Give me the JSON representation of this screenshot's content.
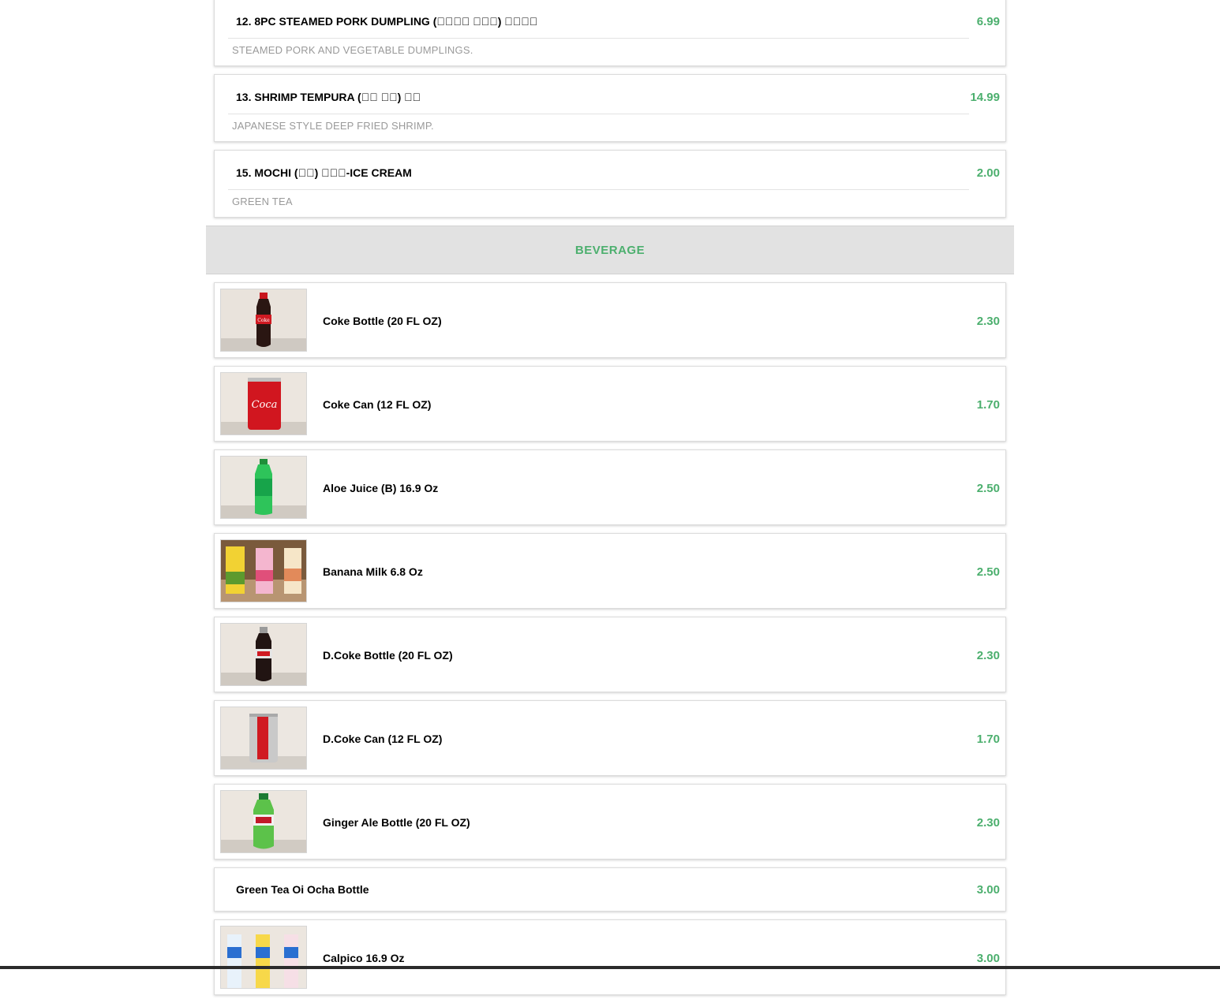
{
  "items_top": [
    {
      "name": "12. 8PC STEAMED PORK DUMPLING (\u0000\u0000\u0000\u0000 \u0000\u0000\u0000) \u0000\u0000\u0000\u0000",
      "desc": "STEAMED PORK AND VEGETABLE DUMPLINGS.",
      "price": "6.99"
    },
    {
      "name": "13. SHRIMP TEMPURA (\u0000\u0000 \u0000\u0000) \u0000\u0000",
      "desc": "JAPANESE STYLE DEEP FRIED SHRIMP.",
      "price": "14.99"
    },
    {
      "name": "15. MOCHI (\u0000\u0000) \u0000\u0000\u0000-ICE CREAM",
      "desc": "GREEN TEA",
      "price": "2.00"
    }
  ],
  "section": {
    "title": "BEVERAGE"
  },
  "beverages": [
    {
      "name": "Coke Bottle (20 FL OZ)",
      "price": "2.30",
      "image": "coke-bottle-photo"
    },
    {
      "name": "Coke Can (12 FL OZ)",
      "price": "1.70",
      "image": "coke-can-photo"
    },
    {
      "name": "Aloe Juice (B) 16.9 Oz",
      "price": "2.50",
      "image": "aloe-juice-photo"
    },
    {
      "name": "Banana Milk 6.8 Oz",
      "price": "2.50",
      "image": "banana-milk-photo"
    },
    {
      "name": "D.Coke Bottle (20 FL OZ)",
      "price": "2.30",
      "image": "diet-coke-bottle-photo"
    },
    {
      "name": "D.Coke Can (12 FL OZ)",
      "price": "1.70",
      "image": "diet-coke-can-photo"
    },
    {
      "name": "Ginger Ale Bottle (20 FL OZ)",
      "price": "2.30",
      "image": "ginger-ale-photo"
    },
    {
      "name": "Green Tea Oi Ocha Bottle",
      "price": "3.00",
      "image": ""
    },
    {
      "name": "Calpico 16.9 Oz",
      "price": "3.00",
      "image": "calpico-photo"
    }
  ],
  "colors": {
    "accent": "#4caf6e",
    "header_bg": "#e2e2e2",
    "desc_text": "#9a9a9a"
  }
}
